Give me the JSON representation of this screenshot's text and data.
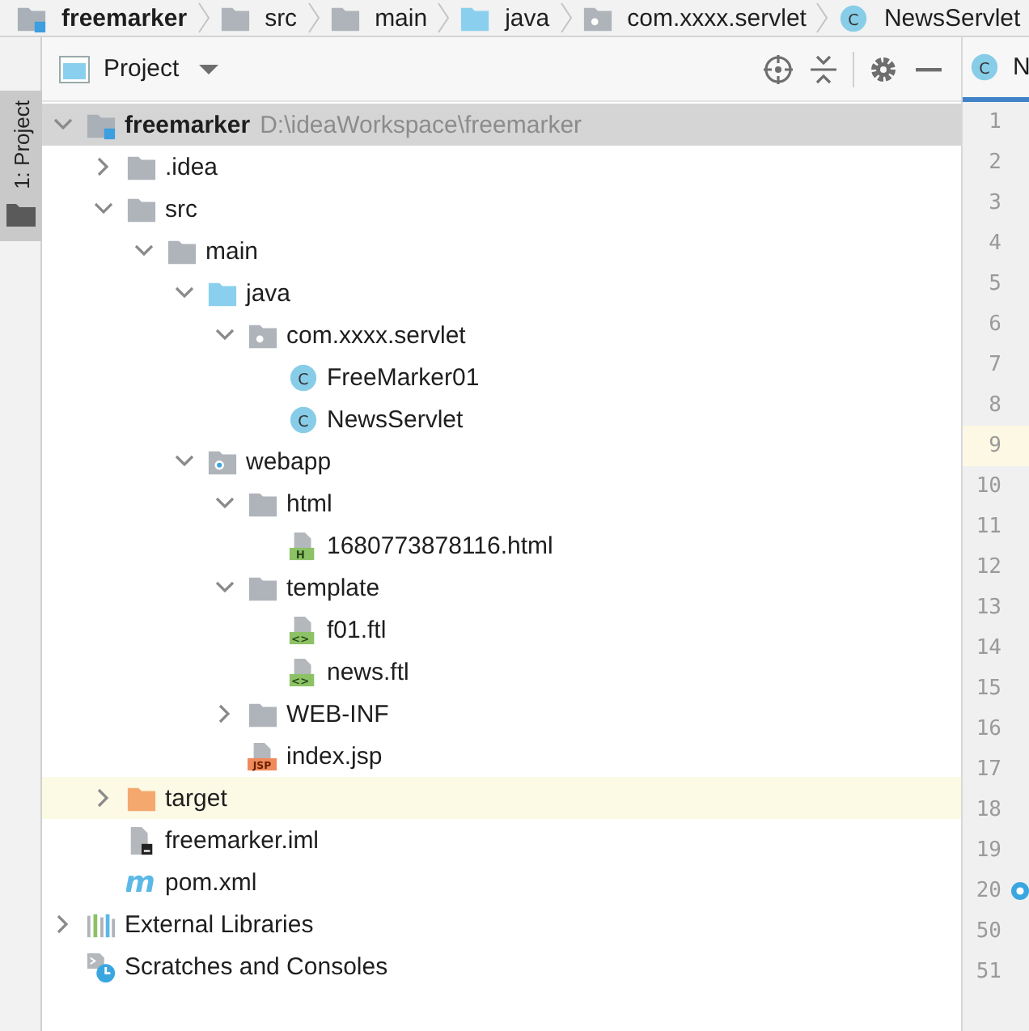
{
  "breadcrumbs": [
    {
      "label": "freemarker",
      "kind": "module"
    },
    {
      "label": "src",
      "kind": "folder"
    },
    {
      "label": "main",
      "kind": "folder"
    },
    {
      "label": "java",
      "kind": "source-folder"
    },
    {
      "label": "com.xxxx.servlet",
      "kind": "package"
    },
    {
      "label": "NewsServlet",
      "kind": "class",
      "badge": "C"
    }
  ],
  "tool_window_stripe": {
    "label": "1: Project",
    "selected": true
  },
  "project_panel": {
    "title": "Project",
    "tree": [
      {
        "label": "freemarker",
        "path": "D:\\ideaWorkspace\\freemarker",
        "kind": "module",
        "selected": true,
        "expanded": true,
        "children": [
          {
            "label": ".idea",
            "kind": "folder",
            "selected": false,
            "expanded": false
          },
          {
            "label": "src",
            "kind": "folder",
            "selected": false,
            "expanded": true,
            "children": [
              {
                "label": "main",
                "kind": "folder",
                "selected": false,
                "expanded": true,
                "children": [
                  {
                    "label": "java",
                    "kind": "source-folder",
                    "selected": false,
                    "expanded": true,
                    "children": [
                      {
                        "label": "com.xxxx.servlet",
                        "kind": "package",
                        "selected": false,
                        "expanded": true,
                        "children": [
                          {
                            "label": "FreeMarker01",
                            "kind": "class",
                            "badge": "C",
                            "selected": false
                          },
                          {
                            "label": "NewsServlet",
                            "kind": "class",
                            "badge": "C",
                            "selected": false
                          }
                        ]
                      }
                    ]
                  },
                  {
                    "label": "webapp",
                    "kind": "web-folder",
                    "selected": false,
                    "expanded": true,
                    "children": [
                      {
                        "label": "html",
                        "kind": "folder",
                        "selected": false,
                        "expanded": true,
                        "children": [
                          {
                            "label": "1680773878116.html",
                            "kind": "html-file",
                            "badge": "H",
                            "selected": false
                          }
                        ]
                      },
                      {
                        "label": "template",
                        "kind": "folder",
                        "selected": false,
                        "expanded": true,
                        "children": [
                          {
                            "label": "f01.ftl",
                            "kind": "ftl-file",
                            "badge": "<>",
                            "selected": false
                          },
                          {
                            "label": "news.ftl",
                            "kind": "ftl-file",
                            "badge": "<>",
                            "selected": false
                          }
                        ]
                      },
                      {
                        "label": "WEB-INF",
                        "kind": "folder",
                        "selected": false,
                        "expanded": false
                      },
                      {
                        "label": "index.jsp",
                        "kind": "jsp-file",
                        "badge": "JSP",
                        "selected": false
                      }
                    ]
                  }
                ]
              }
            ]
          },
          {
            "label": "target",
            "kind": "excluded-folder",
            "selected": false,
            "expanded": false
          },
          {
            "label": "freemarker.iml",
            "kind": "iml-file",
            "selected": false
          },
          {
            "label": "pom.xml",
            "kind": "maven-file",
            "badge": "m",
            "selected": false
          }
        ]
      },
      {
        "label": "External Libraries",
        "kind": "libraries",
        "selected": false,
        "expanded": false
      },
      {
        "label": "Scratches and Consoles",
        "kind": "scratches",
        "selected": false
      }
    ]
  },
  "editor": {
    "tab": {
      "label": "N",
      "badge": "C",
      "selected": true
    },
    "line_numbers": [
      {
        "number": "1",
        "current": false
      },
      {
        "number": "2",
        "current": false
      },
      {
        "number": "3",
        "current": false
      },
      {
        "number": "4",
        "current": false
      },
      {
        "number": "5",
        "current": false
      },
      {
        "number": "6",
        "current": false
      },
      {
        "number": "7",
        "current": false
      },
      {
        "number": "8",
        "current": false
      },
      {
        "number": "9",
        "current": true
      },
      {
        "number": "10",
        "current": false
      },
      {
        "number": "11",
        "current": false
      },
      {
        "number": "12",
        "current": false
      },
      {
        "number": "13",
        "current": false
      },
      {
        "number": "14",
        "current": false
      },
      {
        "number": "15",
        "current": false
      },
      {
        "number": "16",
        "current": false
      },
      {
        "number": "17",
        "current": false
      },
      {
        "number": "18",
        "current": false
      },
      {
        "number": "19",
        "current": false
      },
      {
        "number": "20",
        "current": false,
        "marker": true
      },
      {
        "number": "50",
        "current": false
      },
      {
        "number": "51",
        "current": false
      }
    ]
  }
}
